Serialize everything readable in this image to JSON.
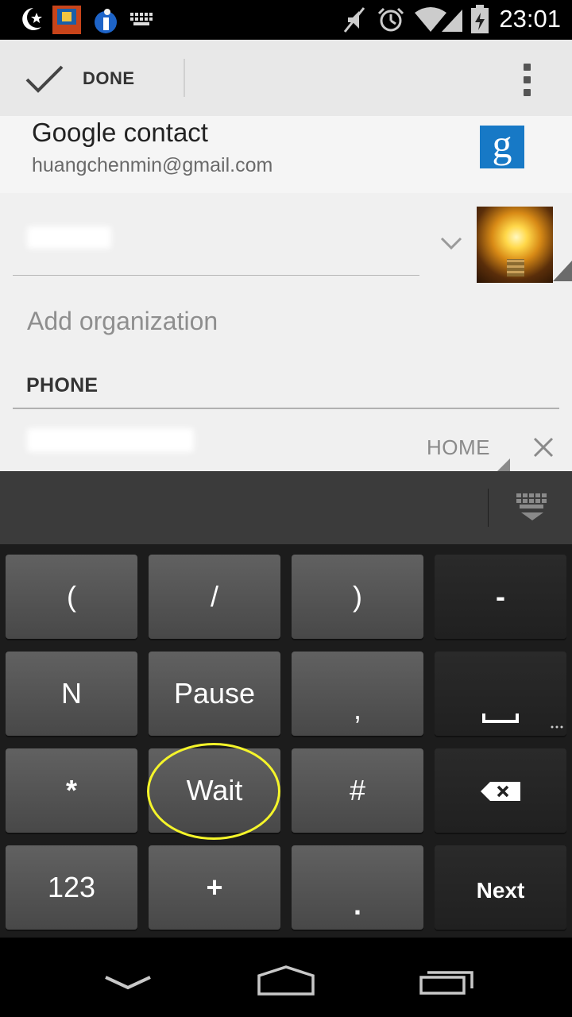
{
  "status_bar": {
    "time": "23:01",
    "icons": [
      "moon-star-icon",
      "app-icon",
      "info-icon",
      "keyboard-icon",
      "mute-icon",
      "alarm-icon",
      "wifi-icon",
      "signal-icon",
      "battery-icon"
    ]
  },
  "action_bar": {
    "done_label": "DONE",
    "icons": [
      "checkmark-icon",
      "overflow-menu-icon"
    ]
  },
  "account": {
    "title": "Google contact",
    "email": "huangchenmin@gmail.com",
    "logo_letter": "g"
  },
  "form": {
    "add_organization": "Add organization",
    "phone_header": "PHONE",
    "phone_type": "HOME"
  },
  "keyboard": {
    "rows": [
      [
        "(",
        "/",
        ")",
        "-"
      ],
      [
        "N",
        "Pause",
        ",",
        ""
      ],
      [
        "*",
        "Wait",
        "#",
        ""
      ],
      [
        "123",
        "+",
        ".",
        "Next"
      ]
    ],
    "colors": {
      "key": "#555555",
      "dark_key": "#242424",
      "highlight_circle": "#f5f52a"
    }
  },
  "nav_bar": {
    "icons": [
      "back-icon",
      "home-icon",
      "recents-icon"
    ]
  }
}
